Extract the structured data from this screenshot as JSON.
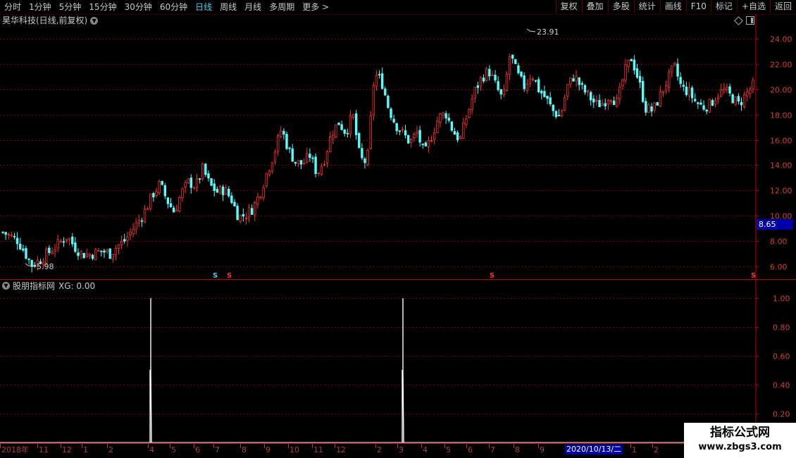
{
  "toolbar": {
    "periods": [
      "分时",
      "1分钟",
      "5分钟",
      "15分钟",
      "30分钟",
      "60分钟",
      "日线",
      "周线",
      "月线",
      "多周期",
      "更多 >"
    ],
    "active_period": "日线",
    "tools": [
      "复权",
      "叠加",
      "多股",
      "统计",
      "画线",
      "F10",
      "标记",
      "+自选",
      "返回"
    ]
  },
  "main_chart": {
    "title": "昊华科技(日线,前复权)",
    "current_price_label": "8.65",
    "high_annotation": "23.91",
    "low_annotation": "5.98",
    "y_ticks": [
      "24.00",
      "22.00",
      "20.00",
      "18.00",
      "16.00",
      "14.00",
      "12.00",
      "10.00",
      "8.00",
      "6.00"
    ],
    "markers": [
      "S",
      "S",
      "S",
      "S"
    ]
  },
  "indicator": {
    "name": "股朋指标网",
    "value_text": "XG: 0.00",
    "y_ticks": [
      "1.00",
      "0.80",
      "0.60",
      "0.40",
      "0.20"
    ]
  },
  "date_axis": {
    "ticks": [
      "2018年",
      "11",
      "12",
      "1",
      "2",
      "4",
      "5",
      "6",
      "7",
      "8",
      "9",
      "10",
      "11",
      "12",
      "2",
      "3",
      "4",
      "5",
      "6",
      "7",
      "8",
      "9",
      "1",
      "2"
    ],
    "cursor_date": "2020/10/13/二"
  },
  "watermark": {
    "title": "指标公式网",
    "url": "www.zbgs3.com"
  },
  "colors": {
    "up": "#ff3232",
    "down": "#54ffff",
    "grid": "#8a0000",
    "axis": "#c00000",
    "highlight": "#0000a8"
  },
  "chart_data": {
    "type": "candlestick",
    "ylim": [
      5.0,
      25.0
    ],
    "series_close_path": [
      8.7,
      8.4,
      8.1,
      7.2,
      6.1,
      6.4,
      6.9,
      7.4,
      7.9,
      8.4,
      7.6,
      7.0,
      6.9,
      7.1,
      7.2,
      7.0,
      7.6,
      8.0,
      8.8,
      9.6,
      10.5,
      11.7,
      12.5,
      11.2,
      10.3,
      11.8,
      12.7,
      12.3,
      13.7,
      12.4,
      11.9,
      12.1,
      11.3,
      9.9,
      10.1,
      10.6,
      11.8,
      13.5,
      15.0,
      16.9,
      15.2,
      14.2,
      14.1,
      14.8,
      13.3,
      14.5,
      16.5,
      17.4,
      16.6,
      18.0,
      14.5,
      14.2,
      21.2,
      20.7,
      18.5,
      17.2,
      16.5,
      15.8,
      16.6,
      14.8,
      16.3,
      17.8,
      18.1,
      16.7,
      16.0,
      18.0,
      19.8,
      20.9,
      21.5,
      20.3,
      19.1,
      22.8,
      21.2,
      20.2,
      21.3,
      20.0,
      19.3,
      18.3,
      17.8,
      20.2,
      21.1,
      20.1,
      19.5,
      18.8,
      18.9,
      19.6,
      18.9,
      21.3,
      22.5,
      20.7,
      18.5,
      18.3,
      19.5,
      20.7,
      21.8,
      20.1,
      19.8,
      19.0,
      18.6,
      18.8,
      19.6,
      19.9,
      19.4,
      18.8,
      19.6,
      20.3
    ],
    "signals_xg": [
      0,
      1,
      0,
      0,
      1,
      0
    ],
    "indicator_ylim": [
      0,
      1.05
    ]
  }
}
